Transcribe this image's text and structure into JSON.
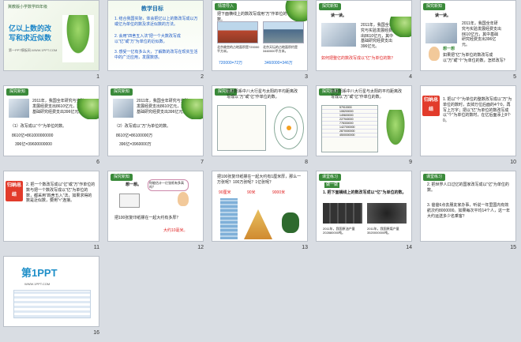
{
  "slides": [
    {
      "num": "1",
      "series": "冀教版小学数学四年级",
      "title_line1": "亿以上数的改",
      "title_line2": "写和求近似数",
      "footer": "第一PPT模板网-WWW.1PPT.COM"
    },
    {
      "num": "2",
      "heading": "教学目标",
      "items": [
        "1. 结合我国实际，体会把亿以上的数改写成以万或亿为单位的数及求近似数的方法。",
        "2. 会用“四舍五入法”把一个大数改写成以“亿”或“万”为单位的近似数。",
        "3. 感受一亿有多么大，了解数的改写在现实生活中的广泛应用，发展数感。"
      ]
    },
    {
      "num": "3",
      "tag": "情境导入",
      "intro": "把下面横线上的数改写成用“万”作单位的数。",
      "cap_left": "北京故宫的占地面积是720000平方米。",
      "cap_right": "北京天坛的占地面积约是3460000平方米。",
      "ans_left": "720000=72万",
      "ans_right": "3460000=346万"
    },
    {
      "num": "4",
      "tag": "探究新知",
      "label": "读一读。",
      "box": "2011年，我国全年研究与实验发展经费支出8610亿元，其中基础研究经费支出396亿元。",
      "question": "如何把整亿的数改写成以“亿”为单位的数？"
    },
    {
      "num": "5",
      "tag": "探究新知",
      "label": "读一读。",
      "box": "2011年，我国全年研究与实验发展经费支出8610亿元，其中基础研究经费支出396亿元。",
      "bubble": "想一想",
      "question": "如果把“亿”为单位的数改写成以“万”或“个”为单位的数，怎样改写？"
    },
    {
      "num": "6",
      "tag": "探究新知",
      "box": "2011年，我国全年研究与实验发展经费支出8610亿元，其中基础研究经费支出396亿元。",
      "line1": "（1）改写成以“个”为单位的数。",
      "line2": "8610亿=861000000000",
      "line3": "396亿=39600000000"
    },
    {
      "num": "7",
      "tag": "探究新知",
      "box": "2011年，我国全年研究与实验发展经费支出8610亿元，其中基础研究经费支出396亿元。",
      "line1": "（2）改写成以“万”为单位的数。",
      "line2": "8610亿=86100000万",
      "line3": "396亿=3960000万"
    },
    {
      "num": "8",
      "tag": "探究新知",
      "heading": "把太阳系中八大行星与太阳的平均距离改写成以“万”或“亿”作单位的数。"
    },
    {
      "num": "9",
      "tag": "探究新知",
      "heading": "把太阳系中八大行星与太阳的平均距离改写成以“万”或“亿”作单位的数。",
      "rows": [
        "57910000",
        "108200000",
        "149600000",
        "227940000",
        "778330000",
        "1427000000",
        "2870000000",
        "4500000000"
      ]
    },
    {
      "num": "10",
      "badge": "归纳总结",
      "text": "1. 把以“个”为单位的整数改写成以“万”为单位的数时，去掉万位后面的4个0，再写上万字；把以“亿”为单位的数改写成以“个”为单位的数时，在亿后面添上8个0。"
    },
    {
      "num": "11",
      "badge": "归纳总结",
      "text": "2. 把一个数改写成以“亿”或“万”作单位的数与把一个数改写成以“亿”为单位的数，都采用“四舍五入”法，如果求得的数是近似数，要用“≈”连接。"
    },
    {
      "num": "12",
      "tag": "探究新知",
      "label": "想一想。",
      "bubble": "你能估计一亿张纸有多高吗？",
      "question": "把100张复印纸摞在一起大约有多厚？",
      "answer": "大约10毫米。"
    },
    {
      "num": "13",
      "tag": "探究新知",
      "heading": "把100张复印纸摞在一起大约有1厘米厚，那么一万张呢？100万张呢？1亿张呢？",
      "v1": "90厘米",
      "v2": "90米",
      "v3": "9000米"
    },
    {
      "num": "14",
      "tag": "课堂练习",
      "label": "做一做",
      "q": "1. 把下面横线上的数改写成以“亿”为单位的数。",
      "cap1": "2011年，我国原油产量202880000吨。",
      "cap2": "2011年，我国原煤产量3520000000吨。"
    },
    {
      "num": "15",
      "tag": "课堂练习",
      "q2": "2. 把世界人口过亿的国家改写成以“亿”为单位的数。",
      "q3": "3. 爸爸6点去朋友家办事，听说一年里国内有效航次约8000000。如果每次平均14个人，这一年大约运送多少名乘客？"
    },
    {
      "num": "16",
      "logo": "第1PPT",
      "tagline": "WWW.1PPT.COM"
    }
  ]
}
